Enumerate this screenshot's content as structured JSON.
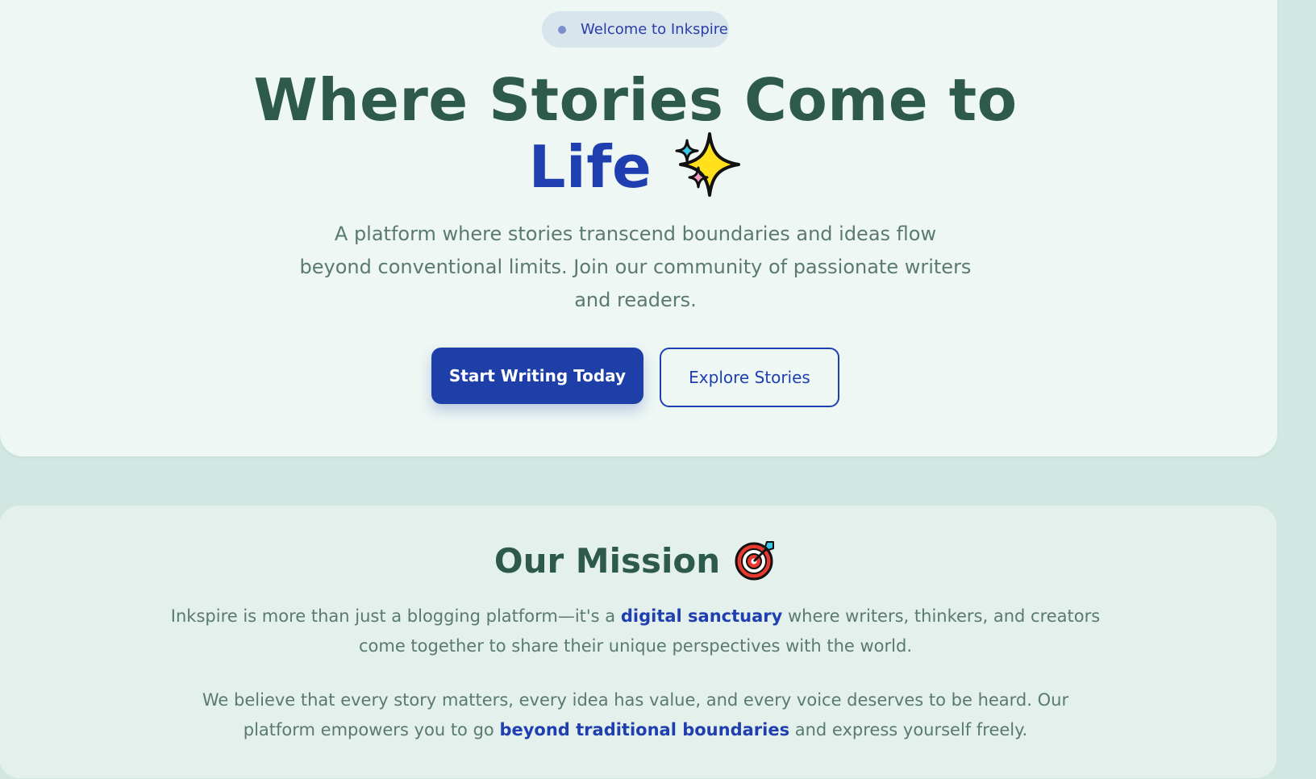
{
  "badge": {
    "text": "Welcome to Inkspire"
  },
  "hero": {
    "title_main": "Where Stories Come to",
    "title_accent": "Life",
    "subtitle": "A platform where stories transcend boundaries and ideas flow beyond conventional limits. Join our community of passionate writers and readers.",
    "primary_button": "Start Writing Today",
    "secondary_button": "Explore Stories"
  },
  "mission": {
    "title": "Our Mission",
    "p1_before": "Inkspire is more than just a blogging platform—it's a ",
    "p1_highlight": "digital sanctuary",
    "p1_after": " where writers, thinkers, and creators come together to share their unique perspectives with the world.",
    "p2_before": "We believe that every story matters, every idea has value, and every voice deserves to be heard. Our platform empowers you to go ",
    "p2_highlight": "beyond traditional boundaries",
    "p2_after": " and express yourself freely."
  },
  "colors": {
    "page_bg": "#d1e7e1",
    "hero_bg": "#eef7f4",
    "heading": "#2d5a4a",
    "accent": "#1f3fb0",
    "body_text": "#5a7a70"
  },
  "icons": {
    "hero_emoji": "sparkles-icon",
    "mission_emoji": "target-icon"
  }
}
